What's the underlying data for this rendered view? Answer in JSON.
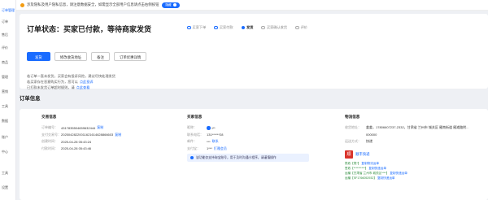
{
  "sidebar": {
    "items": [
      {
        "label": "订单管理"
      },
      {
        "label": "订单"
      },
      {
        "label": "售后"
      },
      {
        "label": "评价"
      },
      {
        "label": "商品"
      },
      {
        "label": "管理"
      },
      {
        "label": "营销"
      },
      {
        "label": "工具"
      },
      {
        "label": "数据"
      },
      {
        "label": "账户"
      },
      {
        "label": "中心"
      },
      {
        "label": "工具"
      },
      {
        "label": "设置"
      }
    ]
  },
  "notice": {
    "text": "涉及隐私及用户隐私信息，请注意数据安全，如需显示全部用户信息请点击右侧按钮",
    "toggle_label": "隐藏"
  },
  "status": {
    "title": "订单状态：买家已付款，等待商家发货",
    "steps": [
      {
        "label": "买家下单",
        "state": "done"
      },
      {
        "label": "买家付款",
        "state": "done"
      },
      {
        "label": "发货",
        "state": "current"
      },
      {
        "label": "买家确认收货",
        "state": "todo"
      },
      {
        "label": "评价",
        "state": "todo"
      }
    ],
    "buttons": {
      "ship": "发货",
      "modify_address": "修改收货地址",
      "remark": "备注",
      "benefit": "订单优惠详情"
    },
    "hints": [
      {
        "text": "若订单一直未发货，买家会有投诉风险，建议尽快处理发货",
        "link": ""
      },
      {
        "text": "若买家存在恶意购买行为，您可以",
        "link": "点此投诉"
      },
      {
        "text": "已打款未发货订单超时规则，请",
        "link": "点此查看"
      }
    ]
  },
  "section_title": "订单信息",
  "trade": {
    "title": "交易信息",
    "rows": [
      {
        "k": "订单编号：",
        "v": "4317835504659632444",
        "a": "复制"
      },
      {
        "k": "支付交易号：",
        "v": "20250428220011621614628866603",
        "a": "复制"
      },
      {
        "k": "创建时间：",
        "v": "2025-04-28 05:43:24",
        "a": ""
      },
      {
        "k": "付款时间：",
        "v": "2025-04-28 05:43:46",
        "a": ""
      }
    ]
  },
  "buyer": {
    "title": "买家信息",
    "rows": [
      {
        "k": "昵称：",
        "v": "t**",
        "a": ""
      },
      {
        "k": "联系电话：",
        "v": "131******28",
        "a": ""
      },
      {
        "k": "邮件：",
        "v": "***",
        "a": "联系"
      },
      {
        "k": "支付宝：",
        "v": "1***",
        "a": "打雅会员"
      }
    ],
    "notice": "该功能仅支持淘宝账号，用于及时沟通小程序，请谨慎操作"
  },
  "logistics": {
    "title": "物流信息",
    "rows": [
      {
        "k": "收货地址：",
        "v": "姜姜，17806607237-2332，甘肃省 兰州市 城关区 雁南街道 雁滩路附...",
        "a": ""
      },
      {
        "k": "",
        "v": "000000",
        "a": ""
      },
      {
        "k": "运送方式：",
        "v": "快递",
        "a": ""
      }
    ],
    "express_name": "顺丰快递",
    "express_logo": "顺",
    "trace": [
      {
        "text": "揽收【揽*】",
        "link": "复制物流运单"
      },
      {
        "text": "签收【**********】",
        "link": "复制快递运单"
      },
      {
        "text": "运输【甘肃省 兰州市 城关区****】",
        "link": "复制快递运单"
      },
      {
        "text": "运输【SF1766052932】",
        "link": "复制快递运单"
      }
    ]
  },
  "colors": {
    "accent": "#1a6cff",
    "trace_green": "#2a8a3a",
    "express_red": "#d9322a"
  }
}
